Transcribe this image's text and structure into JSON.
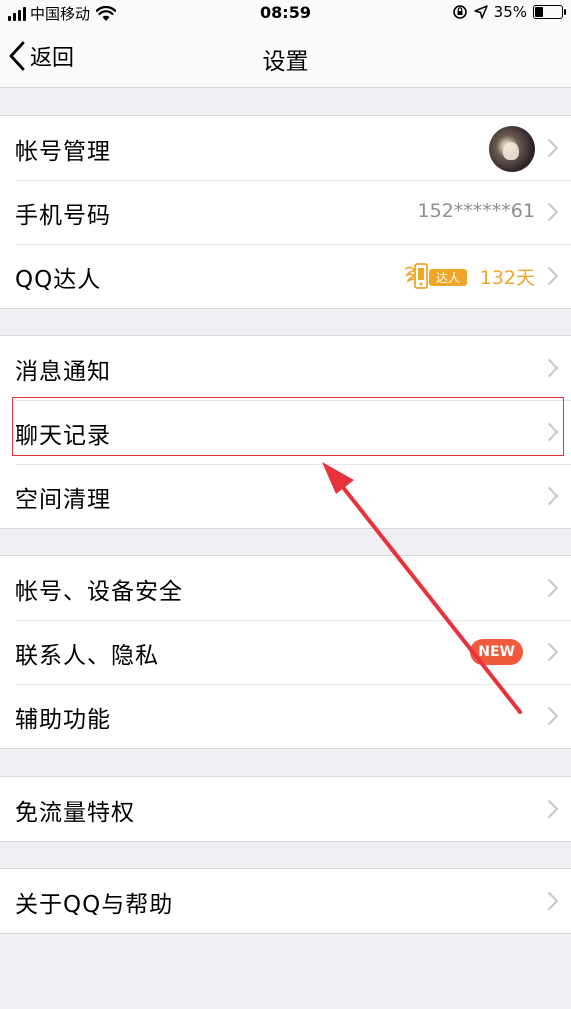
{
  "status_bar": {
    "carrier": "中国移动",
    "time": "08:59",
    "battery_percent": "35%",
    "battery_level": 0.35
  },
  "nav": {
    "back_label": "返回",
    "title": "设置"
  },
  "groups": [
    {
      "rows": [
        {
          "label": "帐号管理"
        },
        {
          "label": "手机号码",
          "value": "152******61"
        },
        {
          "label": "QQ达人",
          "badge": "达人",
          "days": "132天"
        }
      ]
    },
    {
      "rows": [
        {
          "label": "消息通知"
        },
        {
          "label": "聊天记录"
        },
        {
          "label": "空间清理"
        }
      ]
    },
    {
      "rows": [
        {
          "label": "帐号、设备安全"
        },
        {
          "label": "联系人、隐私",
          "badge": "NEW"
        },
        {
          "label": "辅助功能"
        }
      ]
    },
    {
      "rows": [
        {
          "label": "免流量特权"
        }
      ]
    },
    {
      "rows": [
        {
          "label": "关于QQ与帮助"
        }
      ]
    }
  ],
  "colors": {
    "background": "#efeff4",
    "annotation_red": "#e8323c",
    "daren_orange": "#f0a626",
    "new_badge": "#f05a3c"
  }
}
